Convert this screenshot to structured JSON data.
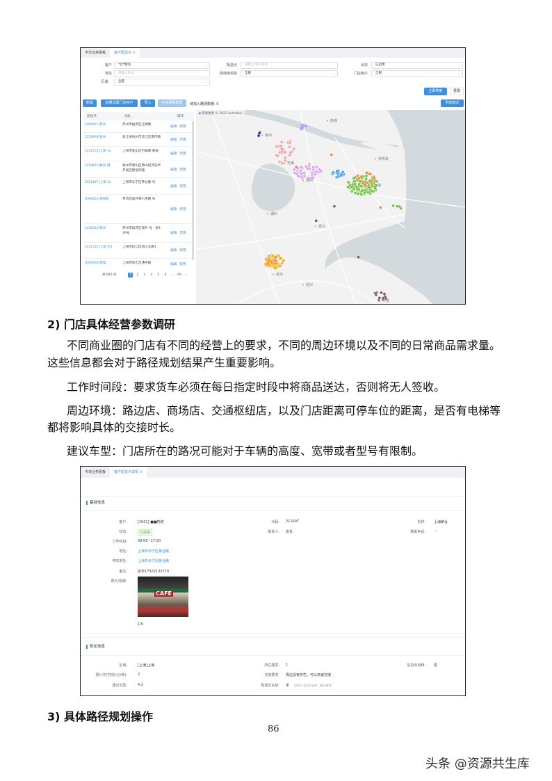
{
  "screenshot1": {
    "tabs": [
      "今日业务看板",
      "客户配送点 ×"
    ],
    "filters": {
      "customer_label": "客户",
      "customer_value": "*云*物流",
      "point_label": "配送点",
      "point_placeholder": "请输入代码/名称",
      "status_label": "状态",
      "status_value": "已启用",
      "address_label": "地址",
      "address_placeholder": "请输入地址",
      "geo_label": "经纬度校验",
      "geo_value": "全部",
      "store_user_label": "门店用户",
      "store_user_value": "全部",
      "region_label": "区域:",
      "region_value": "全部"
    },
    "search_button": "立即搜索",
    "reset_button": "重置",
    "toolbar": {
      "new": "新建",
      "batch": "批量设置门店用户",
      "import": "导入",
      "supplement": "补充路网数据",
      "pending": "待加入路网数量: 0",
      "list_mode": "列表模式"
    },
    "table": {
      "headers": [
        "配送点",
        "地址",
        "操作"
      ],
      "edit": "编辑",
      "disable": "禁用",
      "rows": [
        {
          "name": "[200821]苏州",
          "address": "苏州市姑苏区江婵路",
          "h": 18
        },
        {
          "name": "[210908]杭州",
          "address": "浙江省杭州市滨江区南环路",
          "h": 20
        },
        {
          "name": "[211114]上海 1a",
          "address": "上海市金山区行知路 底层",
          "h": 21
        },
        {
          "name": "[210801]杭州 城",
          "address": "杭州市萧山区萧山经济技术开发区建设四路",
          "h": 24
        },
        {
          "name": "[211007]上海 1a",
          "address": "上海市长宁区茅台路 号",
          "h": 24
        },
        {
          "name": "[090022]海乐超",
          "address": "奉贤区迪外镇人民路 号",
          "h": 42
        },
        {
          "name": "[210202]苏州",
          "address": "苏州市姑苏区溪升 号 - 层1-36号",
          "h": 27
        },
        {
          "name": "[211102]上海 北3",
          "address": "上海市虹口区四川北路1",
          "h": 23
        },
        {
          "name": "[0X0064]新帮",
          "address": "上海市徐汇区漕中路",
          "h": 16
        }
      ]
    },
    "pagination": {
      "total": "共 682 条",
      "pages": [
        "1",
        "2",
        "3",
        "4",
        "5",
        "6",
        "…",
        "69"
      ],
      "current": "1"
    },
    "map": {
      "attribution": "高德地图 © 2022 AutoNavi",
      "cities": [
        {
          "name": "南通"
        },
        {
          "name": "常州"
        },
        {
          "name": "无锡"
        },
        {
          "name": "苏州"
        },
        {
          "name": "上海"
        },
        {
          "name": "崇明岛"
        },
        {
          "name": "湖州"
        },
        {
          "name": "嘉兴"
        },
        {
          "name": "杭州"
        },
        {
          "name": "绍兴"
        },
        {
          "name": "宁波"
        }
      ],
      "cluster_colors": [
        "#6cc340",
        "#f08a2a",
        "#f4a3a3",
        "#d9a6f2",
        "#4a9df5",
        "#9b8cf0",
        "#2a2f8f",
        "#f4ad1a",
        "#7a5a5a"
      ]
    }
  },
  "section2": {
    "heading": "2)  门店具体经营参数调研",
    "p1a": "不同商业圈的门店有不同的经营上的要求，不同的周边环境以及不同的日常商品需求量。",
    "p1b": "这些信息都会对于路径规划结果产生重要影响。",
    "p2": "工作时间段：要求货车必须在每日指定时段中将商品送达，否则将无人签收。",
    "p3a": "周边环境：路边店、商场店、交通枢纽店，以及门店距离可停车位的距离，是否有电梯等",
    "p3b": "都将影响具体的交接时长。",
    "p4": "建议车型：门店所在的路况可能对于车辆的高度、宽带或者型号有限制。"
  },
  "screenshot2": {
    "tabs": [
      "今日业务看板",
      "客户配送点详情 ×"
    ],
    "basic_title": "基础信息",
    "basic": {
      "customer_label": "客户:",
      "customer_value": "[1001] ■■物流",
      "code_label": "代码:",
      "code_value": "211007",
      "name_label": "名称:",
      "name_value": "上海茅台",
      "status_label": "状态:",
      "status_value": "已启用",
      "contact_label": "联系人:",
      "contact_value": "店长",
      "phone_label": "联系电话:",
      "phone_value": "--",
      "hours_label": "工作时段:",
      "hours_value": "08:00~17:00",
      "address_label": "地址:",
      "address_value": "上海市长宁区茅台路",
      "parking_label": "停车地址:",
      "parking_value": "上海市长宁区茅台路",
      "note_label": "备注:",
      "note_value": "店长17502132770",
      "photo_label": "照片/视频:",
      "photo_sign": "CAFE",
      "photo_counter": "1/9"
    },
    "extra_title": "附加信息",
    "extra": {
      "region_label": "区域:",
      "region_value": "[上海]上海",
      "floor_label": "所在楼层:",
      "floor_value": "1",
      "elevator_label": "是否有电梯:",
      "elevator_value": "否",
      "handover_label": "预计交付时长(分钟):",
      "handover_value": "2",
      "req_label": "交接要求:",
      "req_value": "周边没有护栏，可以快速交接",
      "vehicle_label": "建议车型:",
      "vehicle_value": "4.2",
      "priority_label": "配送优先级:",
      "priority_value": "中",
      "priority_note": "(仅用于运力不足时，算法使用)"
    }
  },
  "section3": {
    "heading": "3)  具体路径规划操作"
  },
  "page_number": "86",
  "watermark": "头条 @资源共生库"
}
